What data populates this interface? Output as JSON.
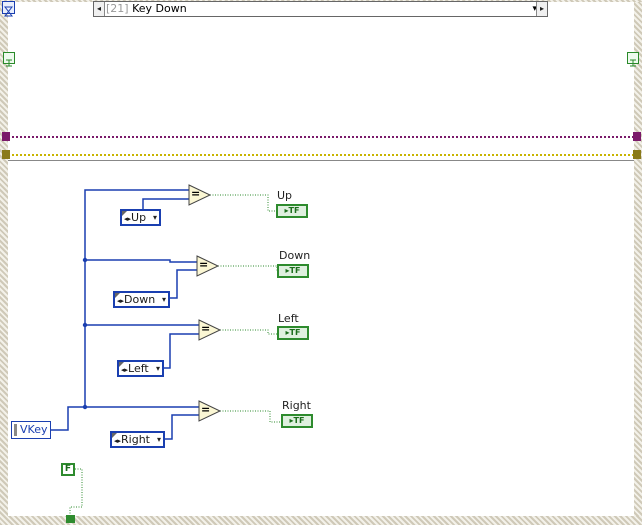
{
  "case_selector": {
    "index_label": "[21]",
    "value_label": "Key Down",
    "prev_arrow": "◂",
    "dropdown_arrow": "▾",
    "next_arrow": "▸"
  },
  "source": {
    "label": "VKey"
  },
  "comparisons": [
    {
      "constant": "Up",
      "indicator": "Up",
      "tf": "▸TF"
    },
    {
      "constant": "Down",
      "indicator": "Down",
      "tf": "▸TF"
    },
    {
      "constant": "Left",
      "indicator": "Left",
      "tf": "▸TF"
    },
    {
      "constant": "Right",
      "indicator": "Right",
      "tf": "▸TF"
    }
  ],
  "operator_symbol": "=",
  "false_constant": "F",
  "enum_dropdown_glyph": "▾",
  "enum_inc_glyph": "◂▸",
  "colors": {
    "enum_wire": "#1a3fb0",
    "bool_wire": "#2e8b2e",
    "refnum_wire": "#7a1a6a",
    "error_wire": "#c8b400"
  }
}
